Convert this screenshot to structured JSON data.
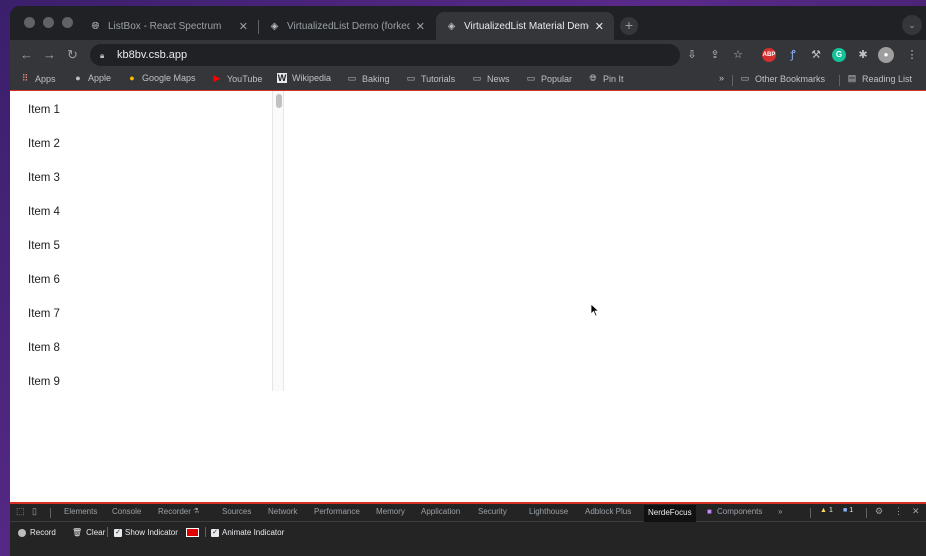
{
  "tabs": [
    {
      "title": "ListBox - React Spectrum",
      "active": false,
      "icon": "globe-icon"
    },
    {
      "title": "VirtualizedList Demo (forked)",
      "active": false,
      "icon": "codesandbox-icon"
    },
    {
      "title": "VirtualizedList Material Demo",
      "active": true,
      "icon": "codesandbox-icon"
    }
  ],
  "toolbar": {
    "url": "kb8bv.csb.app"
  },
  "bookmarks": [
    {
      "label": "Apps",
      "icon": "apps-grid-icon"
    },
    {
      "label": "Apple",
      "icon": "apple-icon"
    },
    {
      "label": "Google Maps",
      "icon": "maps-pin-icon"
    },
    {
      "label": "YouTube",
      "icon": "youtube-icon"
    },
    {
      "label": "Wikipedia",
      "icon": "wikipedia-icon"
    },
    {
      "label": "Baking",
      "icon": "folder-icon"
    },
    {
      "label": "Tutorials",
      "icon": "folder-icon"
    },
    {
      "label": "News",
      "icon": "folder-icon"
    },
    {
      "label": "Popular",
      "icon": "folder-icon"
    },
    {
      "label": "Pin It",
      "icon": "globe-icon"
    }
  ],
  "bookmarks_more": "»",
  "bookmarks_right": [
    {
      "label": "Other Bookmarks",
      "icon": "folder-icon"
    },
    {
      "label": "Reading List",
      "icon": "reading-list-icon"
    }
  ],
  "list": {
    "items": [
      "Item 1",
      "Item 2",
      "Item 3",
      "Item 4",
      "Item 5",
      "Item 6",
      "Item 7",
      "Item 8",
      "Item 9"
    ]
  },
  "devtools": {
    "tabs": [
      "Elements",
      "Console",
      "Recorder",
      "Sources",
      "Network",
      "Performance",
      "Memory",
      "Application",
      "Security",
      "Lighthouse",
      "Adblock Plus",
      "NerdeFocus",
      "Components"
    ],
    "active_tab": "NerdeFocus",
    "more": "»",
    "warnings": "1",
    "messages": "1",
    "controls": {
      "record": "Record",
      "clear": "Clear",
      "show_indicator": "Show Indicator",
      "animate_indicator": "Animate Indicator"
    },
    "indicator_color": "#e00000"
  },
  "colors": {
    "accent_border": "#d93025",
    "chrome_dark": "#202124",
    "chrome_toolbar": "#35363a"
  }
}
